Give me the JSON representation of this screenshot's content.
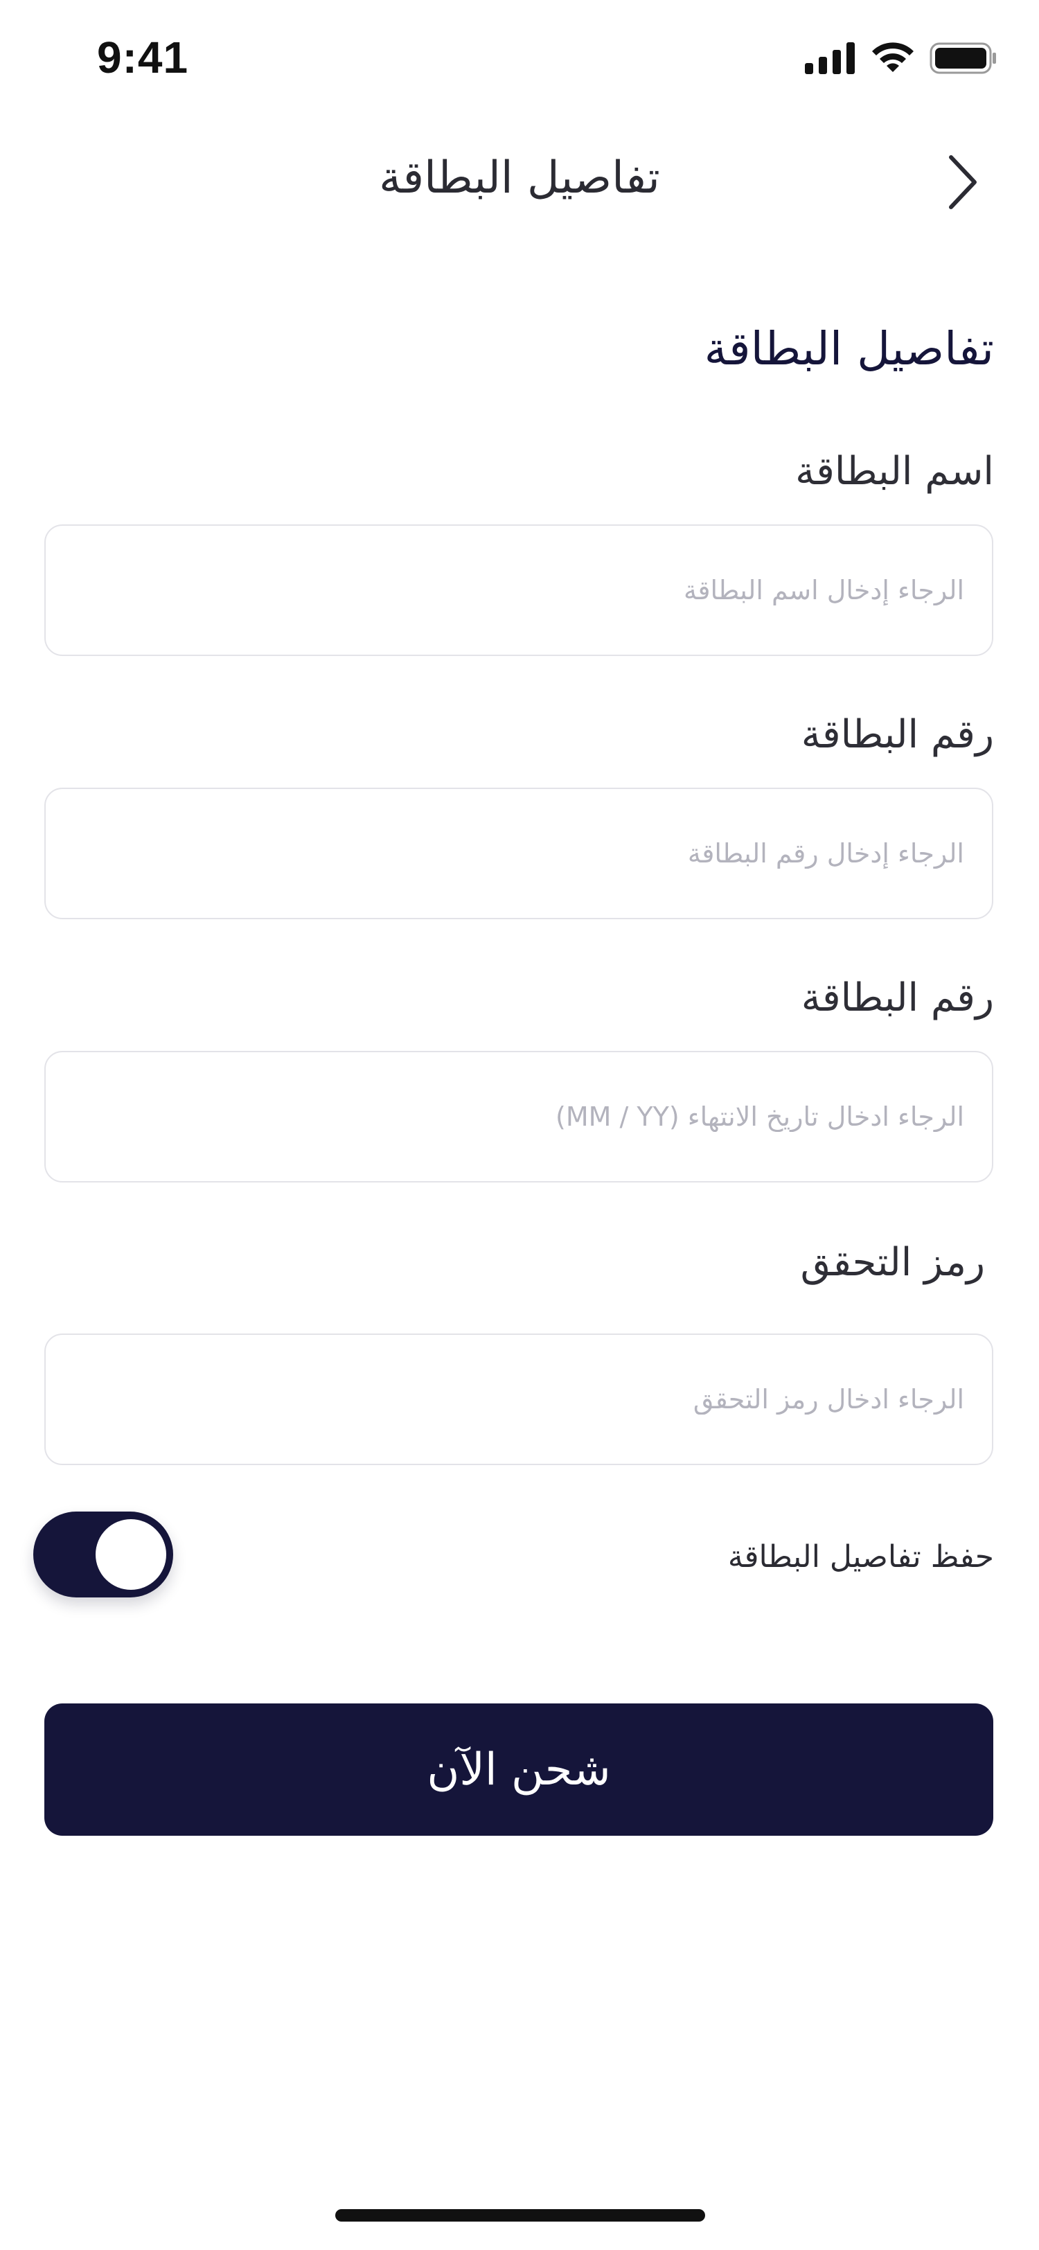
{
  "status_bar": {
    "time": "9:41",
    "icons": [
      "cellular-signal-icon",
      "wifi-icon",
      "battery-icon"
    ]
  },
  "nav": {
    "title": "تفاصيل البطاقة",
    "back_icon": "chevron-right-icon"
  },
  "form": {
    "section_title": "تفاصيل البطاقة",
    "fields": [
      {
        "label": "اسم البطاقة",
        "placeholder": "الرجاء إدخال اسم البطاقة",
        "value": ""
      },
      {
        "label": "رقم البطاقة",
        "placeholder": "الرجاء إدخال رقم البطاقة",
        "value": ""
      },
      {
        "label": "رقم البطاقة",
        "placeholder": "الرجاء ادخال تاريخ الانتهاء (MM / YY)",
        "value": ""
      },
      {
        "label": "رمز التحقق",
        "placeholder": "الرجاء ادخال رمز التحقق",
        "value": ""
      }
    ],
    "save_toggle": {
      "label": "حفظ تفاصيل البطاقة",
      "on": true
    },
    "submit_label": "شحن الآن"
  },
  "colors": {
    "primary": "#15153a",
    "border": "#e3e3e8",
    "placeholder": "#b3b3bd",
    "background": "#ffffff"
  }
}
